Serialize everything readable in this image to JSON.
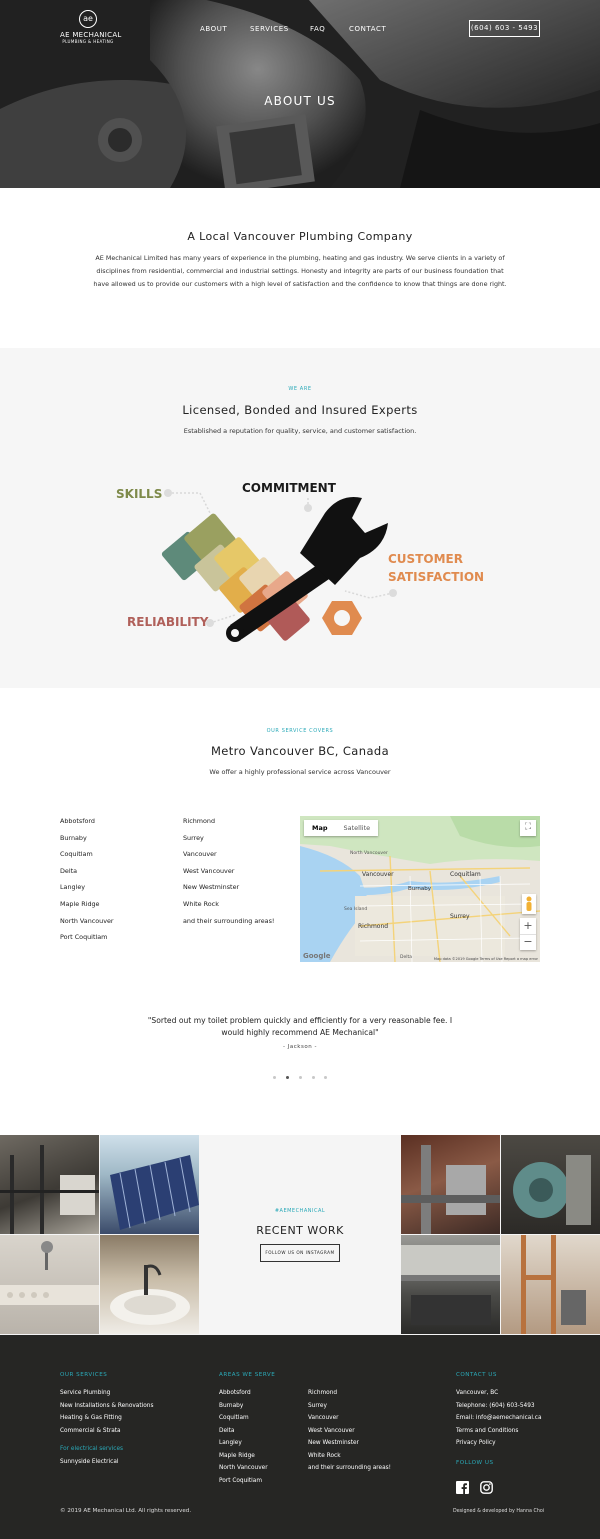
{
  "logo": {
    "mark": "ae",
    "name": "AE MECHANICAL",
    "sub": "PLUMBING & HEATING"
  },
  "nav": {
    "items": [
      "ABOUT",
      "SERVICES",
      "FAQ",
      "CONTACT"
    ],
    "phone": "(604) 603 - 5493"
  },
  "hero": {
    "title": "ABOUT US"
  },
  "intro": {
    "title": "A Local Vancouver Plumbing Company",
    "body": "AE Mechanical Limited has many years of experience in the plumbing, heating and gas industry. We serve clients in a variety of disciplines from residential, commercial and industrial settings. Honesty and integrity are parts of our business foundation that have allowed us to provide our customers with a high level of satisfaction and the confidence to know that things are done right."
  },
  "we_are": {
    "eyebrow": "WE ARE",
    "title": "Licensed, Bonded and Insured Experts",
    "subtitle": "Established a reputation for quality, service, and customer satisfaction.",
    "labels": {
      "skills": "SKILLS",
      "commitment": "COMMITMENT",
      "customer": "CUSTOMER",
      "satisfaction": "SATISFACTION",
      "reliability": "RELIABILITY"
    },
    "colors": {
      "skills": "#7e8a4a",
      "commitment": "#1a1a1a",
      "customer": "#e08b4f",
      "reliability": "#b0605a"
    }
  },
  "coverage": {
    "eyebrow": "OUR SERVICE COVERS",
    "title": "Metro Vancouver BC, Canada",
    "subtitle": "We offer a highly professional service across Vancouver",
    "col1": [
      "Abbotsford",
      "Burnaby",
      "Coquitlam",
      "Delta",
      "Langley",
      "Maple Ridge",
      "North Vancouver",
      "Port Coquitlam"
    ],
    "col2": [
      "Richmond",
      "Surrey",
      "Vancouver",
      "West Vancouver",
      "New Westminster",
      "White Rock",
      "and their surrounding areas!"
    ]
  },
  "map": {
    "tabs": [
      "Map",
      "Satellite"
    ],
    "places": [
      "Vancouver",
      "Burnaby",
      "Coquitlam",
      "Surrey",
      "Richmond",
      "North Vancouver",
      "Sea Island",
      "Delta"
    ],
    "google": "Google",
    "attribution": "Map data ©2019 Google   Terms of Use   Report a map error",
    "zoom_in": "+",
    "zoom_out": "−"
  },
  "testimonial": {
    "quote": "\"Sorted out my toilet problem quickly and efficiently for a very reasonable fee. I would highly recommend AE Mechanical\"",
    "author": "- Jackson -",
    "dots": 5,
    "active_dot": 2
  },
  "work": {
    "eyebrow": "#AEMECHANICAL",
    "title": "RECENT WORK",
    "button": "FOLLOW US ON INSTAGRAM"
  },
  "footer": {
    "services_head": "OUR SERVICES",
    "services": [
      "Service Plumbing",
      "New Installations & Renovations",
      "Heating & Gas Fitting",
      "Commercial & Strata"
    ],
    "electrical_head": "For electrical services",
    "electrical": "Sunnyside Electrical",
    "areas_head": "AREAS WE SERVE",
    "areas1": [
      "Abbotsford",
      "Burnaby",
      "Coquitlam",
      "Delta",
      "Langley",
      "Maple Ridge",
      "North Vancouver",
      "Port Coquitlam"
    ],
    "areas2": [
      "Richmond",
      "Surrey",
      "Vancouver",
      "West Vancouver",
      "New Westminster",
      "White Rock",
      "and their surrounding areas!"
    ],
    "contact_head": "CONTACT US",
    "contact": [
      "Vancouver, BC",
      "Telephone: (604) 603-5493",
      "Email: info@aemechanical.ca",
      "Terms and Conditions",
      "Privacy Policy"
    ],
    "follow_head": "FOLLOW US",
    "social_icons": [
      "facebook-icon",
      "instagram-icon"
    ],
    "copyright": "© 2019 AE Mechanical Ltd. All rights reserved.",
    "credit": "Designed & developed by Hanna Choi"
  }
}
